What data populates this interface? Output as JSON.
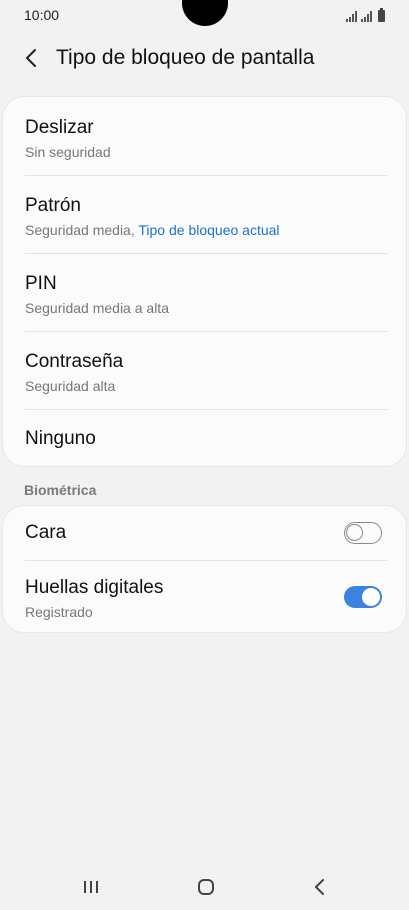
{
  "status_bar": {
    "time": "10:00"
  },
  "header": {
    "title": "Tipo de bloqueo de pantalla",
    "back_icon": "chevron-left-icon"
  },
  "lock_types": [
    {
      "title": "Deslizar",
      "subtitle": "Sin seguridad",
      "subtitle_accent": ""
    },
    {
      "title": "Patrón",
      "subtitle": "Seguridad media, ",
      "subtitle_accent": "Tipo de bloqueo actual"
    },
    {
      "title": "PIN",
      "subtitle": "Seguridad media a alta",
      "subtitle_accent": ""
    },
    {
      "title": "Contraseña",
      "subtitle": "Seguridad alta",
      "subtitle_accent": ""
    },
    {
      "title": "Ninguno",
      "subtitle": "",
      "subtitle_accent": ""
    }
  ],
  "biometrics": {
    "section_label": "Biométrica",
    "items": [
      {
        "title": "Cara",
        "subtitle": "",
        "enabled": false
      },
      {
        "title": "Huellas digitales",
        "subtitle": "Registrado",
        "enabled": true
      }
    ]
  },
  "colors": {
    "accent": "#1a73c9",
    "toggle_on": "#3a83e0",
    "background": "#f2f2f2",
    "card": "#fbfbfb"
  },
  "nav_bar": {
    "recents_icon": "recents-icon",
    "home_icon": "home-icon",
    "back_icon": "back-icon"
  }
}
